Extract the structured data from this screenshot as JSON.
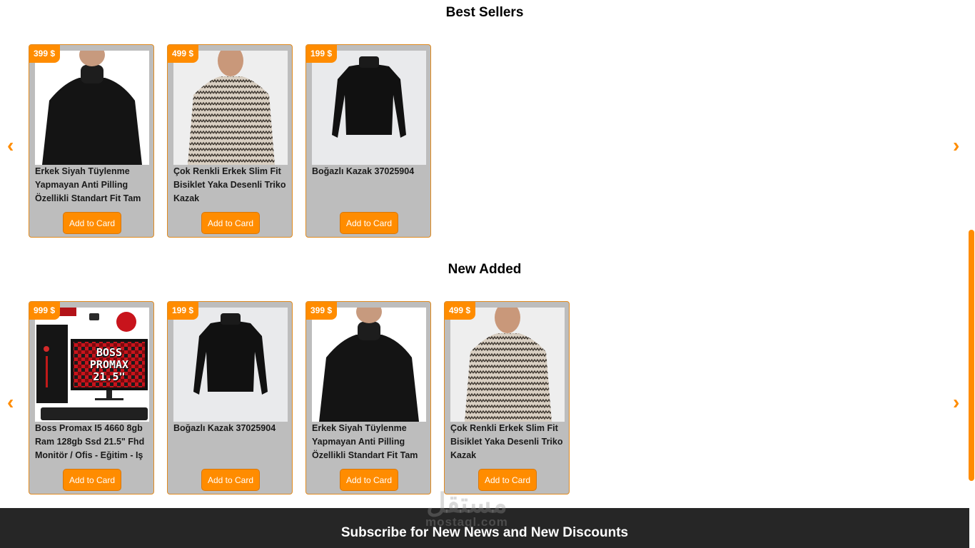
{
  "sections": {
    "best_sellers": {
      "title": "Best Sellers",
      "products": [
        {
          "price": "399 $",
          "name": "Erkek Siyah Tüylenme Yapmayan Anti Pilling Özellikli Standart Fit Tam",
          "button": "Add to Card",
          "image": "black-turtleneck-man"
        },
        {
          "price": "499 $",
          "name": "Çok Renkli Erkek Slim Fit Bisiklet Yaka Desenli Triko Kazak",
          "button": "Add to Card",
          "image": "patterned-sweater-man"
        },
        {
          "price": "199 $",
          "name": "Boğazlı Kazak 37025904",
          "button": "Add to Card",
          "image": "black-turtleneck-flat"
        }
      ]
    },
    "new_added": {
      "title": "New Added",
      "products": [
        {
          "price": "999 $",
          "name": "Boss Promax I5 4660 8gb Ram 128gb Ssd 21.5\" Fhd Monitör / Ofis - Eğitim - Iş",
          "button": "Add to Card",
          "image": "pc-bundle",
          "image_text": [
            "BOSS",
            "PROMAX",
            "21.5\""
          ]
        },
        {
          "price": "199 $",
          "name": "Boğazlı Kazak 37025904",
          "button": "Add to Card",
          "image": "black-turtleneck-flat"
        },
        {
          "price": "399 $",
          "name": "Erkek Siyah Tüylenme Yapmayan Anti Pilling Özellikli Standart Fit Tam",
          "button": "Add to Card",
          "image": "black-turtleneck-man"
        },
        {
          "price": "499 $",
          "name": "Çok Renkli Erkek Slim Fit Bisiklet Yaka Desenli Triko Kazak",
          "button": "Add to Card",
          "image": "patterned-sweater-man"
        }
      ]
    }
  },
  "arrows": {
    "prev": "‹",
    "next": "›"
  },
  "footer": {
    "subscribe_title": "Subscribe for New News and New Discounts"
  },
  "watermark": {
    "main": "مستقل",
    "sub": "mostaql.com"
  },
  "colors": {
    "accent": "#ff8c00",
    "card_bg": "#bdbdbd",
    "footer_bg": "#262626"
  }
}
